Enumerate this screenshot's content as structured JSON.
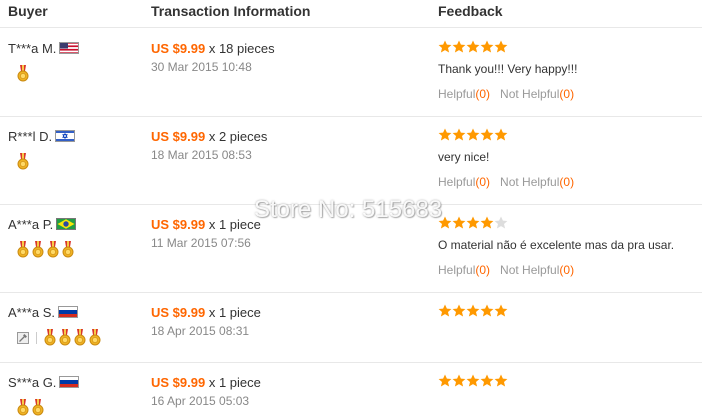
{
  "header": {
    "buyer": "Buyer",
    "transaction": "Transaction Information",
    "feedback": "Feedback"
  },
  "rows": [
    {
      "buyer": "T***a M.",
      "flag": "us-flag",
      "medals": 1,
      "price": "US $9.99",
      "qty": "x 18 pieces",
      "date": "30 Mar 2015 10:48",
      "rating": 5,
      "comment": "Thank you!!! Very happy!!!",
      "helpful_label": "Helpful",
      "helpful_count": "(0)",
      "not_helpful_label": "Not Helpful",
      "not_helpful_count": "(0)"
    },
    {
      "buyer": "R***l D.",
      "flag": "il-flag",
      "medals": 1,
      "price": "US $9.99",
      "qty": "x 2 pieces",
      "date": "18 Mar 2015 08:53",
      "rating": 5,
      "comment": "very nice!",
      "helpful_label": "Helpful",
      "helpful_count": "(0)",
      "not_helpful_label": "Not Helpful",
      "not_helpful_count": "(0)"
    },
    {
      "buyer": "A***a P.",
      "flag": "br-flag",
      "medals": 4,
      "price": "US $9.99",
      "qty": "x 1 piece",
      "date": "11 Mar 2015 07:56",
      "rating": 4,
      "comment": "O material não é excelente mas da pra usar.",
      "helpful_label": "Helpful",
      "helpful_count": "(0)",
      "not_helpful_label": "Not Helpful",
      "not_helpful_count": "(0)"
    },
    {
      "buyer": "A***a S.",
      "flag": "ru-flag",
      "medals": 4,
      "price": "US $9.99",
      "qty": "x 1 piece",
      "date": "18 Apr 2015 08:31",
      "rating": 5,
      "comment": "",
      "helpful_label": "",
      "helpful_count": "",
      "not_helpful_label": "",
      "not_helpful_count": ""
    },
    {
      "buyer": "S***a G.",
      "flag": "ru-flag",
      "medals": 2,
      "price": "US $9.99",
      "qty": "x 1 piece",
      "date": "16 Apr 2015 05:03",
      "rating": 5,
      "comment": "",
      "helpful_label": "",
      "helpful_count": "",
      "not_helpful_label": "",
      "not_helpful_count": ""
    }
  ],
  "watermark": "Store No: 515683",
  "colors": {
    "price": "#ff6600",
    "star_on": "#ff9900",
    "star_off": "#dddddd",
    "medal": "#f0b323"
  }
}
